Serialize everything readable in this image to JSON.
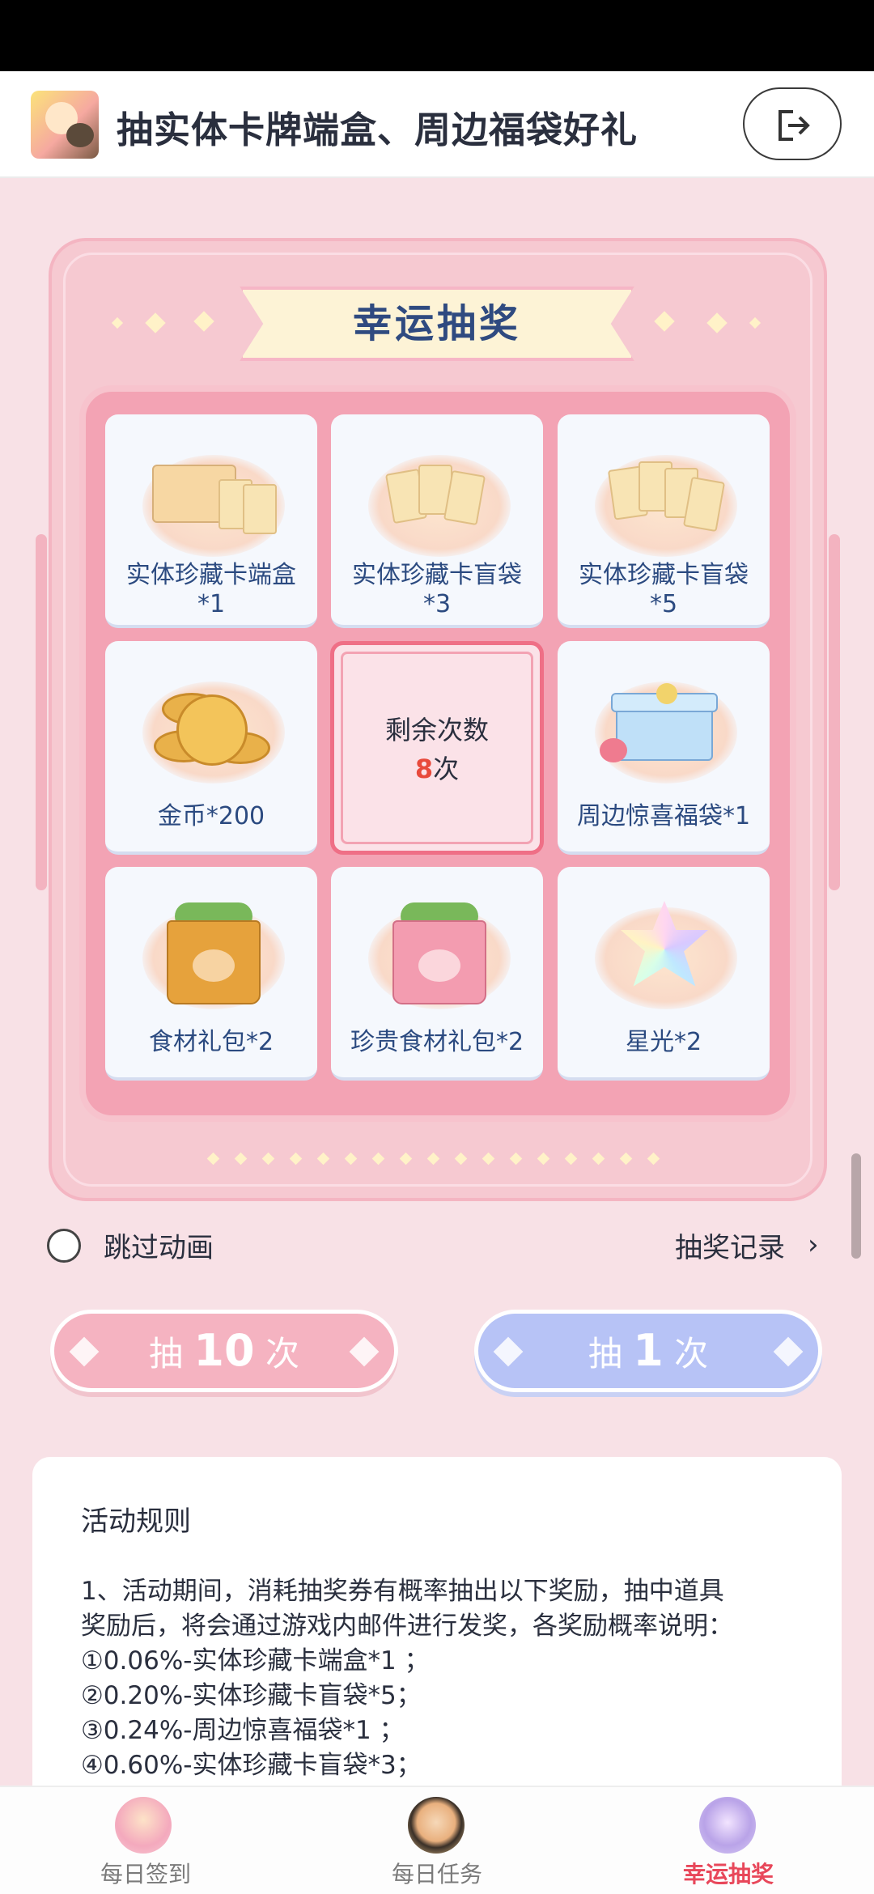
{
  "header": {
    "title": "抽实体卡牌端盒、周边福袋好礼",
    "exit_icon": "logout-icon"
  },
  "panel": {
    "banner_title": "幸运抽奖",
    "prizes": [
      {
        "label": "实体珍藏卡端盒",
        "qty": "*1",
        "icon": "card-box-icon"
      },
      {
        "label": "实体珍藏卡盲袋",
        "qty": "*3",
        "icon": "card-packs-icon"
      },
      {
        "label": "实体珍藏卡盲袋",
        "qty": "*5",
        "icon": "card-packs-icon"
      },
      {
        "label": "金币*200",
        "icon": "gold-coins-icon"
      },
      {
        "label": "周边惊喜福袋*1",
        "icon": "gift-box-icon"
      },
      {
        "label": "食材礼包*2",
        "icon": "grocery-bag-icon"
      },
      {
        "label": "珍贵食材礼包*2",
        "icon": "grocery-bag-pink-icon"
      },
      {
        "label": "星光*2",
        "icon": "starlight-icon"
      }
    ],
    "remaining_title": "剩余次数",
    "remaining_count": "8",
    "remaining_unit": "次"
  },
  "options": {
    "skip_label": "跳过动画",
    "record_label": "抽奖记录"
  },
  "buttons": {
    "draw_ten_prefix": "抽",
    "draw_ten_num": "10",
    "draw_ten_suffix": "次",
    "draw_one_prefix": "抽",
    "draw_one_num": "1",
    "draw_one_suffix": "次"
  },
  "rules": {
    "title": "活动规则",
    "lines": [
      "1、活动期间，消耗抽奖券有概率抽出以下奖励，抽中道具",
      "奖励后，将会通过游戏内邮件进行发奖，各奖励概率说明：",
      "①0.06%-实体珍藏卡端盒*1 ；",
      "②0.20%-实体珍藏卡盲袋*5；",
      "③0.24%-周边惊喜福袋*1 ；",
      "④0.60%-实体珍藏卡盲袋*3；"
    ]
  },
  "nav": [
    {
      "label": "每日签到",
      "active": false
    },
    {
      "label": "每日任务",
      "active": false
    },
    {
      "label": "幸运抽奖",
      "active": true
    }
  ],
  "colors": {
    "accent_red": "#e8475a",
    "panel_pink": "#f6c9d1",
    "button_blue": "#b7c3f6",
    "button_pink": "#f5b3c1"
  }
}
